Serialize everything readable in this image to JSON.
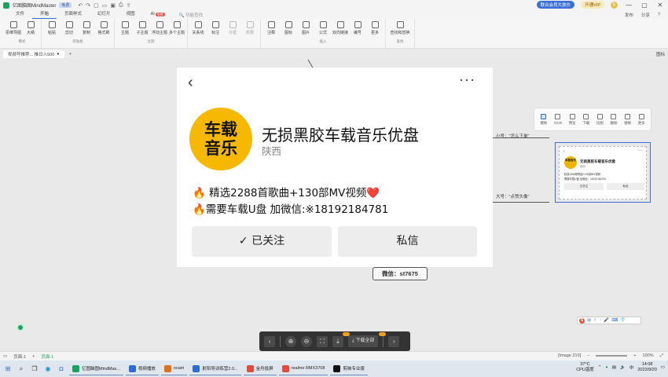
{
  "titlebar": {
    "app_name": "亿图脑图MindMaster",
    "badge": "免费",
    "vip_label": "联合会员大放价",
    "open_vip": "开通VIP",
    "avatar_letter": "E"
  },
  "menu": {
    "tabs": [
      "文件",
      "开始",
      "页面样式",
      "幻灯片",
      "视图",
      "AI"
    ],
    "active_tab": "开始",
    "ai_badge": "免费",
    "search_placeholder": "功能查找",
    "right_items": [
      "发布",
      "分享",
      "?"
    ]
  },
  "ribbon": {
    "groups": [
      {
        "label": "模式",
        "buttons": [
          "思维导图",
          "大纲"
        ]
      },
      {
        "label": "剪贴板",
        "buttons": [
          "粘贴",
          "剪切",
          "复制",
          "格式刷"
        ]
      },
      {
        "label": "主题",
        "buttons": [
          "主题",
          "子主题",
          "浮动主题",
          "多个主题"
        ]
      },
      {
        "label": "",
        "buttons": [
          "关系线",
          "标注",
          "外框",
          "概要"
        ]
      },
      {
        "label": "插入",
        "buttons": [
          "注释",
          "图标",
          "图片",
          "公式",
          "双向链接",
          "编号",
          "更多"
        ]
      },
      {
        "label": "查找",
        "buttons": [
          "查找和替换"
        ]
      }
    ]
  },
  "doctabs": {
    "tab_label": "视频号推荐... 推日入500",
    "right_label": "图标"
  },
  "canvas": {
    "label_small": "小号：\"怎么下单\"",
    "label_large": "大号：\"点赞头像\"",
    "wechat_node": "微信：st7675"
  },
  "float_tools": [
    "擦除",
    "OCR",
    "预览",
    "下载",
    "比图",
    "删除",
    "替换",
    "更多"
  ],
  "thumbnail": {
    "logo": "车载音乐",
    "title": "无损黑胶车载音乐优盘",
    "sub": "陕西",
    "line1": "精选2288首歌曲+130部MV视频",
    "line2": "需要车载U盘 加微信：18192184781",
    "btn_follow": "已关注",
    "btn_msg": "私信"
  },
  "modal": {
    "logo_line1": "车载",
    "logo_line2": "音乐",
    "title": "无损黑胶车载音乐优盘",
    "subtitle": "陕西",
    "line1": "🔥 精选2288首歌曲+130部MV视频❤️",
    "line2": "🔥需要车载U盘 加微信:※18192184781",
    "follow_button": "✓ 已关注",
    "message_button": "私信"
  },
  "viewer_bar": {
    "download_label": "下载全部"
  },
  "statusbar": {
    "page_label": "页面-1",
    "page_tab": "页面-1",
    "image_info": "[Image 210]",
    "zoom": "100%"
  },
  "taskbar": {
    "apps": [
      {
        "label": "亿图脑图MindMas...",
        "color": "#1aa260"
      },
      {
        "label": "视频播放",
        "color": "#2e6bd6"
      },
      {
        "label": "ocam",
        "color": "#e0701a"
      },
      {
        "label": "射阳导训练营2.0...",
        "color": "#2e6bd6"
      },
      {
        "label": "金舟投屏",
        "color": "#e84a3a"
      },
      {
        "label": "realme RMX3708",
        "color": "#e84a3a"
      },
      {
        "label": "剪映专业版",
        "color": "#111111"
      }
    ],
    "weather": "37°C",
    "cpu": "CPU温度",
    "time": "14:08",
    "date": "2023/9/20"
  }
}
